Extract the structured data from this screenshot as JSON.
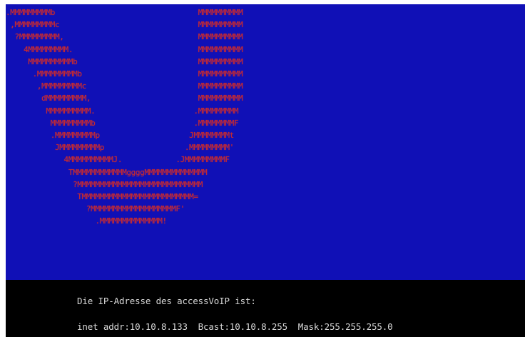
{
  "colors": {
    "art_background": "#1010b6",
    "art_text": "#c82a2a",
    "console_background": "#000000",
    "console_text": "#d8d8d8"
  },
  "ascii_art": [
    ".MMMMMMMMMb                                MMMMMMMMMM",
    " ,MMMMMMMMMc                               MMMMMMMMMM",
    "  ?MMMMMMMMM,                              MMMMMMMMMM",
    "    4MMMMMMMMM.                            MMMMMMMMMM",
    "     MMMMMMMMMMb                           MMMMMMMMMM",
    "      .MMMMMMMMMb                          MMMMMMMMMM",
    "       ,MMMMMMMMMc                         MMMMMMMMMM",
    "        dMMMMMMMMM,                        MMMMMMMMMM",
    "         MMMMMMMMMM.                      .MMMMMMMMM",
    "          MMMMMMMMMb                      .MMMMMMMMF",
    "          .MMMMMMMMMp                    JMMMMMMMMt",
    "           JMMMMMMMMMp                  .MMMMMMMMM'",
    "             4MMMMMMMMMMJ.            .JMMMMMMMMMF",
    "              TMMMMMMMMMMMMggggMMMMMMMMMMMMMM",
    "               ?MMMMMMMMMMMMMMMMMMMMMMMMMMMM",
    "                TMMMMMMMMMMMMMMMMMMMMMMMMM=",
    "                  ?MMMMMMMMMMMMMMMMMMMF'",
    "                    .MMMMMMMMMMMMMM!"
  ],
  "console": {
    "line1": "Die IP-Adresse des accessVoIP ist:",
    "line2": "inet addr:10.10.8.133  Bcast:10.10.8.255  Mask:255.255.255.0"
  }
}
